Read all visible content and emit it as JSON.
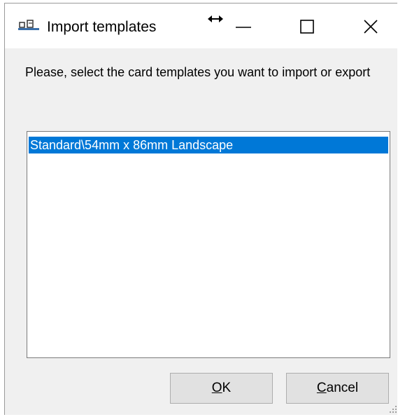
{
  "window": {
    "title": "Import templates",
    "app_icon": "card-templates-icon",
    "caption_buttons": [
      "minimize-icon",
      "maximize-icon",
      "close-icon"
    ]
  },
  "dialog": {
    "prompt": "Please, select the card templates you want to import or export",
    "templates": [
      {
        "label": "Standard\\54mm x 86mm Landscape",
        "selected": true
      }
    ],
    "ok": {
      "mnemonic": "O",
      "rest": "K"
    },
    "cancel": {
      "mnemonic": "C",
      "rest": "ancel"
    }
  },
  "colors": {
    "selection": "#0078d7",
    "dialog_bg": "#f0f0f0",
    "button_bg": "#e1e1e1"
  }
}
